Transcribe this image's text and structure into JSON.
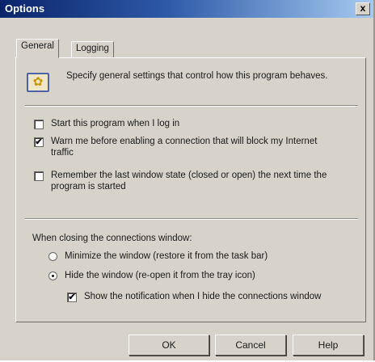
{
  "window": {
    "title": "Options",
    "close_glyph": "x"
  },
  "tabs": [
    {
      "label": "General",
      "selected": true
    },
    {
      "label": "Logging",
      "selected": false
    }
  ],
  "general": {
    "info_icon": "settings-info-icon",
    "info_text": "Specify general settings that control how this program behaves.",
    "options": [
      {
        "label": "Start this program when I log in",
        "checked": false
      },
      {
        "label": "Warn me before enabling a connection that will block my Internet traffic",
        "checked": true
      },
      {
        "label": "Remember the last window state (closed or open) the next time the program is started",
        "checked": false
      }
    ],
    "closing_label": "When closing the connections window:",
    "closing_options": [
      {
        "label": "Minimize the window (restore it from the task bar)",
        "selected": false
      },
      {
        "label": "Hide the window (re-open it from the tray icon)",
        "selected": true
      }
    ],
    "notification_option": {
      "label": "Show the notification when I hide the connections window",
      "checked": true
    }
  },
  "buttons": {
    "ok": "OK",
    "cancel": "Cancel",
    "help": "Help"
  },
  "check_glyph": "✔"
}
